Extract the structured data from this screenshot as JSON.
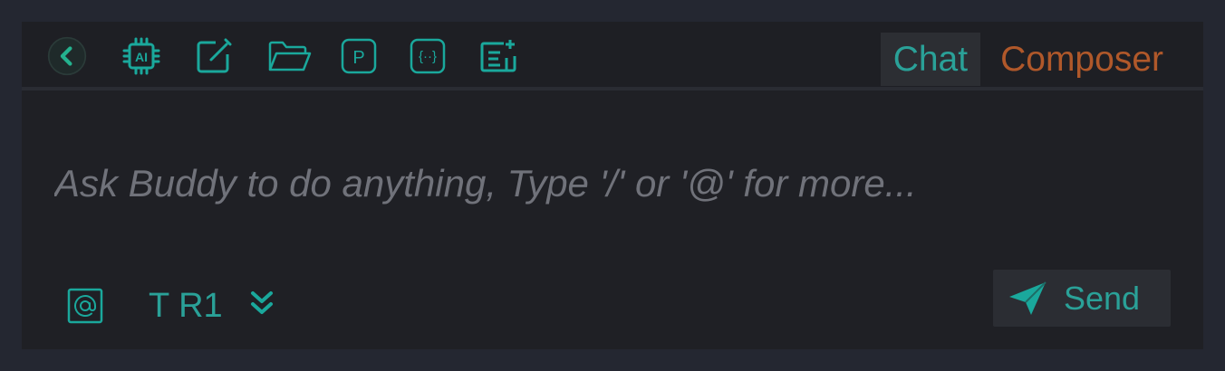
{
  "toolbar": {
    "icons": [
      {
        "name": "back-chevron-icon"
      },
      {
        "name": "ai-chip-icon",
        "text": "AI"
      },
      {
        "name": "edit-note-icon"
      },
      {
        "name": "folder-open-icon"
      },
      {
        "name": "p-box-icon",
        "text": "P"
      },
      {
        "name": "code-braces-icon",
        "text": "{··}"
      },
      {
        "name": "add-list-icon"
      }
    ],
    "tabs": [
      {
        "label": "Chat",
        "active": true
      },
      {
        "label": "Composer",
        "active": false
      }
    ]
  },
  "input": {
    "placeholder": "Ask Buddy to do anything, Type '/' or '@' for more..."
  },
  "footer": {
    "mention_icon": "at-sign-icon",
    "model_label": "T R1",
    "model_chevron_icon": "double-chevron-down-icon",
    "send_label": "Send",
    "send_icon": "paper-plane-icon"
  },
  "colors": {
    "accent": "#2aa198",
    "inactive_tab": "#b0582a",
    "placeholder": "#70727a",
    "background": "#1f2025"
  }
}
